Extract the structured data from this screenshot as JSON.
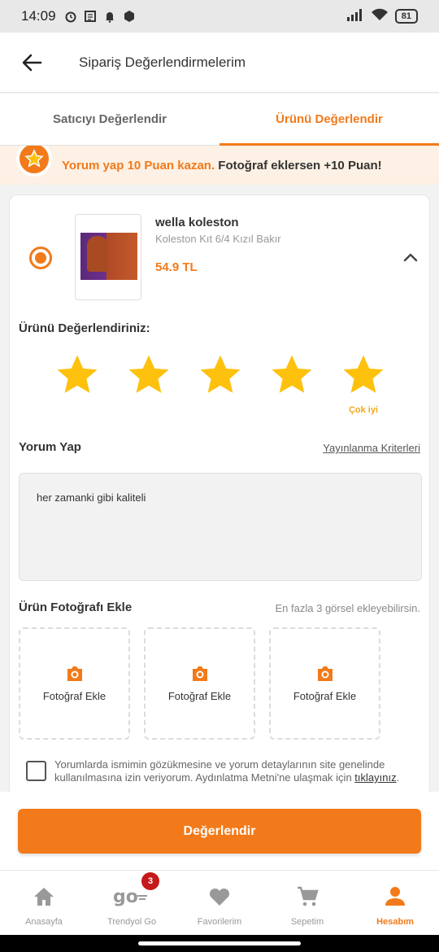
{
  "status_bar": {
    "time": "14:09",
    "battery": "81"
  },
  "header": {
    "title": "Sipariş Değerlendirmelerim"
  },
  "tabs": [
    {
      "label": "Satıcıyı Değerlendir",
      "active": false
    },
    {
      "label": "Ürünü Değerlendir",
      "active": true
    }
  ],
  "promo": {
    "orange_text": "Yorum yap 10 Puan kazan.",
    "dark_text": "Fotoğraf eklersen +10 Puan!"
  },
  "product": {
    "name": "wella koleston",
    "variant": "Koleston Kıt 6/4 Kızıl Bakır",
    "price": "54.9 TL",
    "selected": true
  },
  "rating": {
    "label": "Ürünü Değerlendiriniz:",
    "value": 5,
    "max": 5,
    "caption": "Çok iyi"
  },
  "comment": {
    "label": "Yorum Yap",
    "criteria_link": "Yayınlanma Kriterleri",
    "text": "her zamanki gibi kaliteli"
  },
  "photos": {
    "label": "Ürün Fotoğrafı Ekle",
    "hint": "En fazla 3 görsel ekleyebilirsin.",
    "slots": [
      {
        "label": "Fotoğraf Ekle",
        "icon": "camera-icon"
      },
      {
        "label": "Fotoğraf Ekle",
        "icon": "camera-icon"
      },
      {
        "label": "Fotoğraf Ekle",
        "icon": "camera-icon"
      }
    ]
  },
  "consent": {
    "text": "Yorumlarda ismimin gözükmesine ve yorum detaylarının site genelinde kullanılmasına izin veriyorum. Aydınlatma Metni'ne ulaşmak için ",
    "link": "tıklayınız",
    "suffix": ".",
    "checked": false
  },
  "submit": {
    "label": "Değerlendir"
  },
  "bottom_nav": [
    {
      "label": "Anasayfa",
      "icon": "home-icon",
      "active": false
    },
    {
      "label": "Trendyol Go",
      "icon": "go-icon",
      "active": false,
      "badge": "3"
    },
    {
      "label": "Favorilerim",
      "icon": "heart-icon",
      "active": false
    },
    {
      "label": "Sepetim",
      "icon": "cart-icon",
      "active": false
    },
    {
      "label": "Hesabım",
      "icon": "user-icon",
      "active": true
    }
  ],
  "colors": {
    "accent": "#f27a1a",
    "star": "#fec10d",
    "promo_bg": "#fdf0e4"
  }
}
